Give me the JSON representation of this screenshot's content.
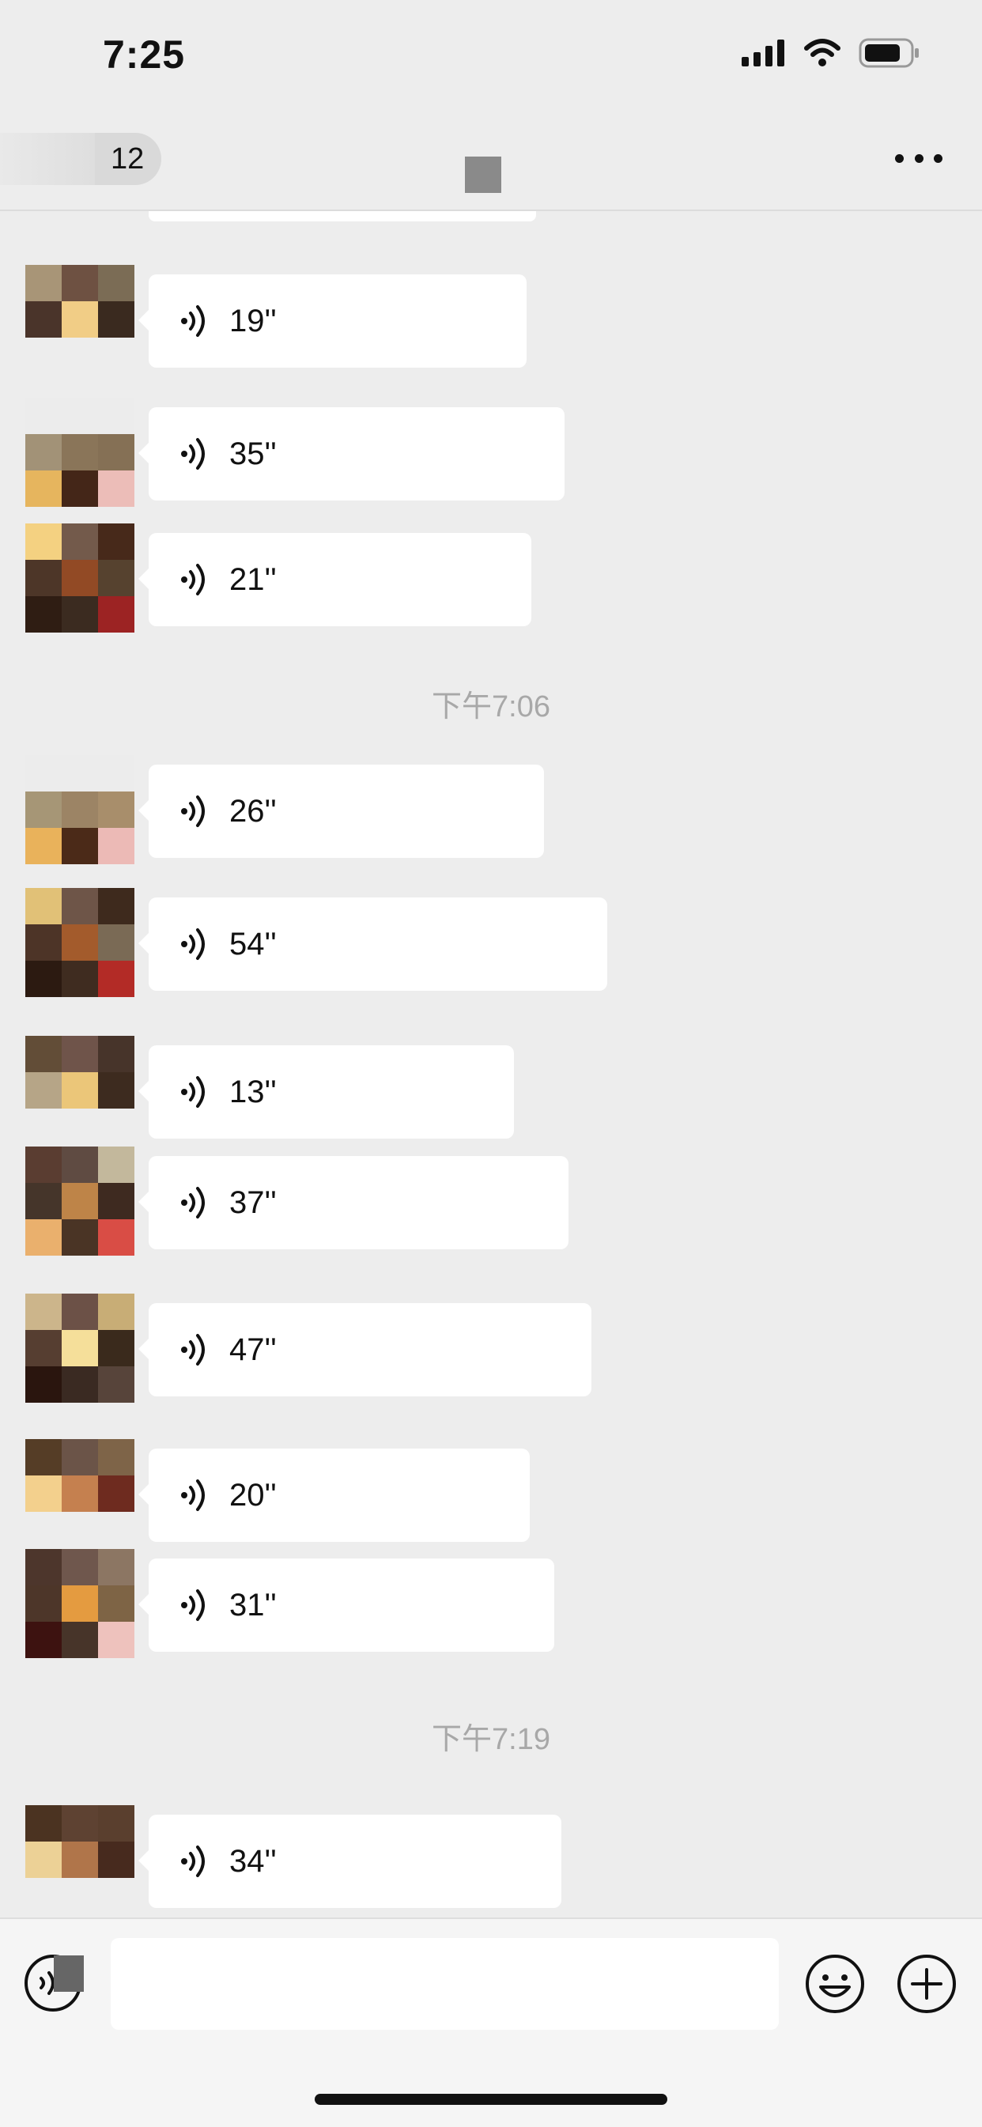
{
  "status_bar": {
    "time": "7:25",
    "icons": [
      "signal-icon",
      "wifi-icon",
      "battery-icon"
    ]
  },
  "nav": {
    "back_count": "12",
    "more_icon": "more-icon"
  },
  "messages": [
    {
      "type": "voice",
      "duration": "19''",
      "colors": [
        "#a89577",
        "#6e5142",
        "#7b6c55",
        "#4a342a",
        "#f1cd86",
        "#3a2a1f",
        "#ededed",
        "#ededed",
        "#ededed"
      ]
    },
    {
      "type": "voice",
      "duration": "35''",
      "colors": [
        "#ececec",
        "#ececec",
        "#ececec",
        "#a29277",
        "#8a7559",
        "#857055",
        "#e6b55e",
        "#442618",
        "#ecbdb8"
      ]
    },
    {
      "type": "voice",
      "duration": "21''",
      "colors": [
        "#f4d181",
        "#735a4b",
        "#47291a",
        "#4d3628",
        "#924a25",
        "#56422f",
        "#2f1d13",
        "#3b2b20",
        "#9c2323"
      ]
    },
    {
      "type": "timestamp",
      "text": "下午7:06"
    },
    {
      "type": "voice",
      "duration": "26''",
      "colors": [
        "#ececec",
        "#ececec",
        "#ececec",
        "#a69676",
        "#9c8465",
        "#a88e6b",
        "#e9b25b",
        "#4b2a18",
        "#ecbab6"
      ]
    },
    {
      "type": "voice",
      "duration": "54''",
      "colors": [
        "#e1c177",
        "#6e5548",
        "#3e2a1d",
        "#4d3427",
        "#a35b2c",
        "#7a6a55",
        "#2c1a11",
        "#3f2c20",
        "#b32b26"
      ]
    },
    {
      "type": "voice",
      "duration": "13''",
      "colors": [
        "#624d37",
        "#6f544a",
        "#47342a",
        "#b6a587",
        "#ebc679",
        "#3d2b1f",
        "#ededed",
        "#ededed",
        "#ededed"
      ]
    },
    {
      "type": "voice",
      "duration": "37''",
      "colors": [
        "#5a3d31",
        "#5f4b42",
        "#c3b89c",
        "#45352a",
        "#be8448",
        "#3e2a20",
        "#eab06d",
        "#4a3425",
        "#d94d45"
      ]
    },
    {
      "type": "voice",
      "duration": "47''",
      "colors": [
        "#ccb58b",
        "#6c5147",
        "#c8ad76",
        "#563e31",
        "#f5df9a",
        "#3a2a1c",
        "#2a150e",
        "#3a2a22",
        "#57443a"
      ]
    },
    {
      "type": "voice",
      "duration": "20''",
      "colors": [
        "#553d26",
        "#6b5448",
        "#7e6448",
        "#f3d08d",
        "#c5804f",
        "#6e2b1f",
        "#ededed",
        "#ededed",
        "#ededed"
      ]
    },
    {
      "type": "voice",
      "duration": "31''",
      "colors": [
        "#4d362c",
        "#6f574d",
        "#8c7663",
        "#4d3629",
        "#e49b40",
        "#7e6445",
        "#3d1210",
        "#473429",
        "#eec2bd"
      ]
    },
    {
      "type": "timestamp",
      "text": "下午7:19"
    },
    {
      "type": "voice",
      "duration": "34''",
      "colors": [
        "#4b3321",
        "#5e4232",
        "#5a3f2e",
        "#ecd196",
        "#b0754a",
        "#472a1e",
        "#ededed",
        "#ededed",
        "#ededed"
      ]
    }
  ],
  "input_bar": {
    "placeholder": "",
    "voice_icon": "voice-toggle-icon",
    "emoji_icon": "emoji-icon",
    "plus_icon": "plus-icon"
  }
}
